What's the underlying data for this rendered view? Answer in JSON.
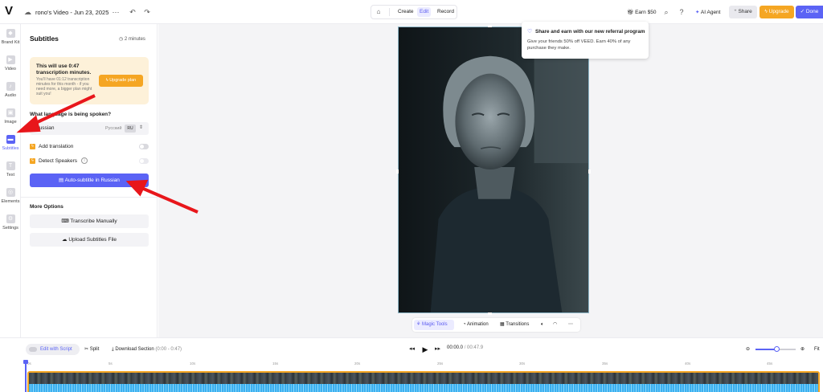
{
  "topbar": {
    "logo": "V",
    "project_title": "rono's Video - Jun 23, 2025",
    "modes": [
      "Create",
      "Edit",
      "Record"
    ],
    "active_mode": "Edit",
    "earn_label": "Earn $50",
    "ai_agent_label": "AI Agent",
    "share_label": "Share",
    "upgrade_label": "Upgrade",
    "done_label": "Done"
  },
  "rail": {
    "items": [
      {
        "label": "Brand Kit",
        "icon": "brand-kit-icon"
      },
      {
        "label": "Video",
        "icon": "video-icon"
      },
      {
        "label": "Audio",
        "icon": "audio-icon"
      },
      {
        "label": "Image",
        "icon": "image-icon"
      },
      {
        "label": "Subtitles",
        "icon": "subtitles-icon"
      },
      {
        "label": "Text",
        "icon": "text-icon"
      },
      {
        "label": "Elements",
        "icon": "elements-icon"
      },
      {
        "label": "Settings",
        "icon": "settings-icon"
      }
    ],
    "active": "Subtitles"
  },
  "panel": {
    "title": "Subtitles",
    "minutes": "2 minutes",
    "promo": {
      "title": "This will use 0:47 transcription minutes.",
      "text": "You'll have 01:12 transcription minutes for this month - if you need more, a bigger plan might suit you!",
      "button": "Upgrade plan"
    },
    "language_question": "What language is being spoken?",
    "language": {
      "name": "Russian",
      "native": "Русский",
      "code": "RU"
    },
    "add_translation": "Add translation",
    "detect_speakers": "Detect Speakers",
    "auto_subtitle_button": "Auto-subtitle in Russian",
    "more_options_title": "More Options",
    "transcribe_manually": "Transcribe Manually",
    "upload_subtitles": "Upload Subtitles File"
  },
  "referral": {
    "title": "Share and earn with our new referral program",
    "text": "Give your friends 50% off VEED. Earn 40% of any purchase they make."
  },
  "video_controls": {
    "magic_tools": "Magic Tools",
    "animation": "Animation",
    "transitions": "Transitions"
  },
  "timeline": {
    "edit_with_script": "Edit with Script",
    "split": "Split",
    "download_section": "Download Section",
    "download_range": "(0:00 - 0:47)",
    "current_time": "00:00.0",
    "separator": "/",
    "total_time": "00:47.9",
    "fit": "Fit",
    "zoom_level": 0.52,
    "ruler_ticks": [
      "0s",
      "5s",
      "10s",
      "15s",
      "20s",
      "25s",
      "30s",
      "35s",
      "40s",
      "45s"
    ]
  },
  "colors": {
    "accent": "#5b63f5",
    "upgrade": "#f5a623",
    "annotation_arrow": "#e8161b"
  }
}
